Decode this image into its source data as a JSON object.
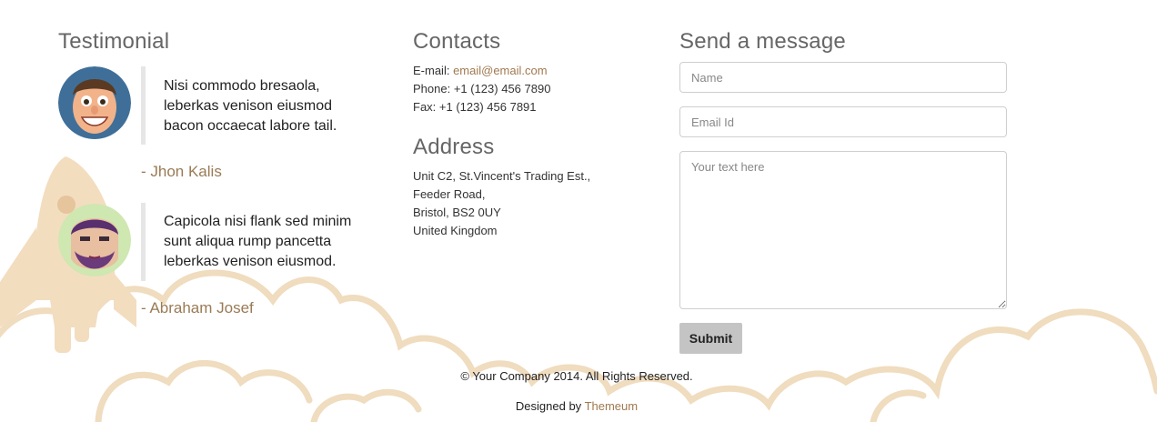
{
  "testimonial": {
    "title": "Testimonial",
    "items": [
      {
        "quote": "Nisi commodo bresaola, leberkas venison eiusmod bacon occaecat labore tail.",
        "author": "- Jhon Kalis"
      },
      {
        "quote": "Capicola nisi flank sed minim sunt aliqua rump pancetta leberkas venison eiusmod.",
        "author": "- Abraham Josef"
      }
    ]
  },
  "contacts": {
    "title": "Contacts",
    "email_label": "E-mail: ",
    "email": "email@email.com",
    "phone": "Phone: +1 (123) 456 7890",
    "fax": "Fax: +1 (123) 456 7891"
  },
  "address": {
    "title": "Address",
    "lines": [
      "Unit C2, St.Vincent's Trading Est.,",
      "Feeder Road,",
      "Bristol, BS2 0UY",
      "United Kingdom"
    ]
  },
  "message_form": {
    "title": "Send a message",
    "name_placeholder": "Name",
    "email_placeholder": "Email Id",
    "text_placeholder": "Your text here",
    "submit_label": "Submit"
  },
  "footer": {
    "copyright": "© Your Company 2014. All Rights Reserved.",
    "designed_by": "Designed by ",
    "designer": "Themeum"
  },
  "colors": {
    "accent": "#9a7b54",
    "link": "#a0794f",
    "illustration": "#f1dcbd"
  },
  "icons": [
    "rocket-illustration",
    "clouds-illustration",
    "avatar-cartoon-man",
    "avatar-bearded-man"
  ]
}
